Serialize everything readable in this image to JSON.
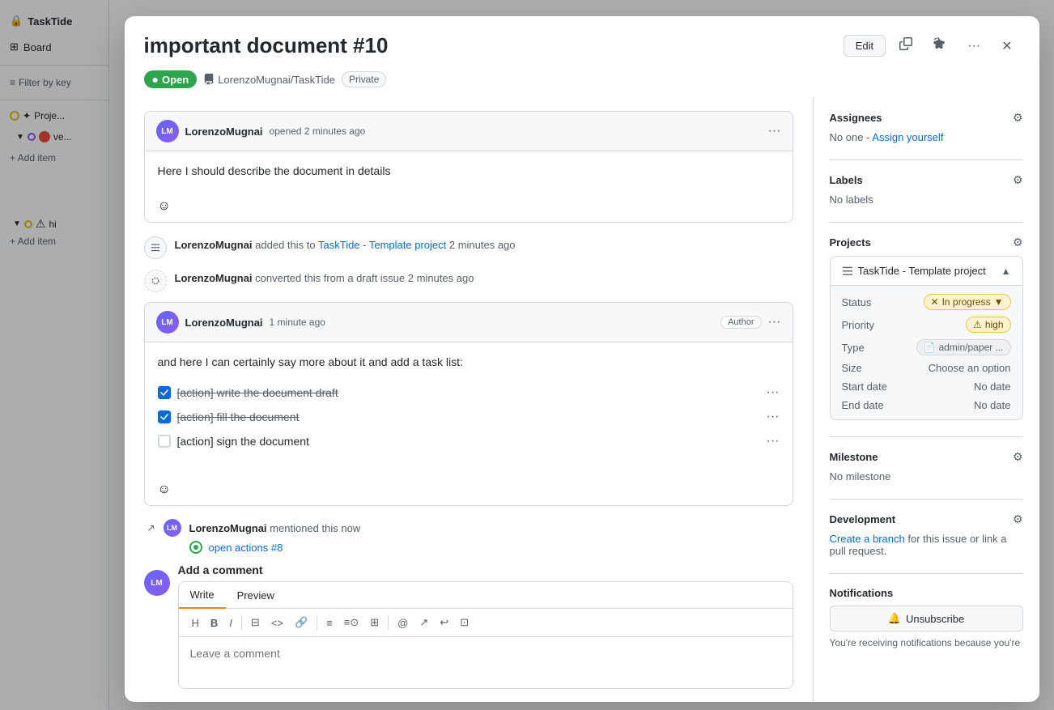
{
  "app": {
    "title": "TaskTide",
    "sidebar": {
      "board_label": "Board",
      "filter_label": "Filter by key",
      "projects": [
        {
          "label": "Proje..."
        },
        {
          "label": "ve..."
        }
      ],
      "add_item_labels": [
        "+ Add item",
        "+ Add item"
      ]
    }
  },
  "modal": {
    "title": "important document #10",
    "status": "Open",
    "repo": "LorenzoMugnai/TaskTide",
    "visibility": "Private",
    "header_buttons": {
      "edit": "Edit",
      "copy": "⧉",
      "pin": "📌",
      "more": "···",
      "close": "✕"
    }
  },
  "comments": [
    {
      "id": "comment-1",
      "author": "LorenzoMugnai",
      "time": "opened 2 minutes ago",
      "body": "Here I should describe the document in details",
      "is_author": false
    },
    {
      "id": "comment-2",
      "author": "LorenzoMugnai",
      "time": "1 minute ago",
      "body": "and here I can certainly say more about it and add a task list:",
      "is_author": true,
      "tasks": [
        {
          "label": "[action] write the document draft",
          "checked": true
        },
        {
          "label": "[action] fill the document",
          "checked": true
        },
        {
          "label": "[action] sign the document",
          "checked": false
        }
      ]
    }
  ],
  "activity": [
    {
      "icon": "grid",
      "text_parts": [
        "LorenzoMugnai",
        " added this to ",
        "TaskTide - Template project",
        " 2 minutes ago"
      ]
    },
    {
      "icon": "circle-dashed",
      "text_parts": [
        "LorenzoMugnai",
        " converted this from a draft issue ",
        "2 minutes ago"
      ]
    }
  ],
  "mentioned": {
    "author": "LorenzoMugnai",
    "time": "mentioned this now",
    "link_text": "open actions #8"
  },
  "add_comment": {
    "tab_write": "Write",
    "tab_preview": "Preview",
    "placeholder": "Leave a comment",
    "toolbar": [
      "H",
      "B",
      "I",
      "⊟",
      "<>",
      "🔗",
      "≡",
      "≡⊙",
      "⊞",
      "@",
      "↗",
      "↩",
      "⊡"
    ]
  },
  "right_panel": {
    "assignees": {
      "title": "Assignees",
      "no_one": "No one",
      "assign_yourself": "Assign yourself"
    },
    "labels": {
      "title": "Labels",
      "no_labels": "No labels"
    },
    "projects": {
      "title": "Projects",
      "project_name": "TaskTide - Template project",
      "status_label": "Status",
      "status_value": "In progress",
      "priority_label": "Priority",
      "priority_value": "high",
      "type_label": "Type",
      "type_value": "admin/paper ...",
      "size_label": "Size",
      "size_value": "Choose an option",
      "start_date_label": "Start date",
      "start_date_value": "No date",
      "end_date_label": "End date",
      "end_date_value": "No date"
    },
    "milestone": {
      "title": "Milestone",
      "value": "No milestone"
    },
    "development": {
      "title": "Development",
      "link_text": "Create a branch",
      "description": " for this issue or link a pull request."
    },
    "notifications": {
      "title": "Notifications",
      "btn_label": "Unsubscribe",
      "note": "You're receiving notifications because you're"
    }
  }
}
